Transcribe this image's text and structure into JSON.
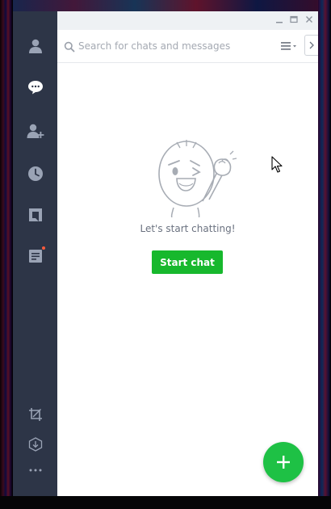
{
  "sidebar": {
    "items": [
      {
        "icon": "profile-icon",
        "active": false
      },
      {
        "icon": "chat-bubble-icon",
        "active": true
      },
      {
        "icon": "add-friend-icon",
        "active": false
      },
      {
        "icon": "clock-icon",
        "active": false
      },
      {
        "icon": "timeline-icon",
        "active": false
      },
      {
        "icon": "notes-icon",
        "active": false,
        "badge": true
      }
    ],
    "bottom_items": [
      {
        "icon": "screenshot-crop-icon"
      },
      {
        "icon": "download-icon"
      },
      {
        "icon": "more-dots-icon"
      }
    ]
  },
  "titlebar": {
    "buttons": [
      "minimize-icon",
      "maximize-icon",
      "close-icon"
    ]
  },
  "search": {
    "placeholder": "Search for chats and messages",
    "value": ""
  },
  "empty_state": {
    "message": "Let's start chatting!",
    "button_label": "Start chat"
  },
  "fab": {
    "icon": "plus-icon"
  },
  "colors": {
    "sidebar_bg": "#2d3547",
    "sidebar_icon": "#9aa3b5",
    "sidebar_icon_active": "#ffffff",
    "accent_green": "#17b82d",
    "fab_green": "#1ec145",
    "badge": "#ff5a3c"
  }
}
